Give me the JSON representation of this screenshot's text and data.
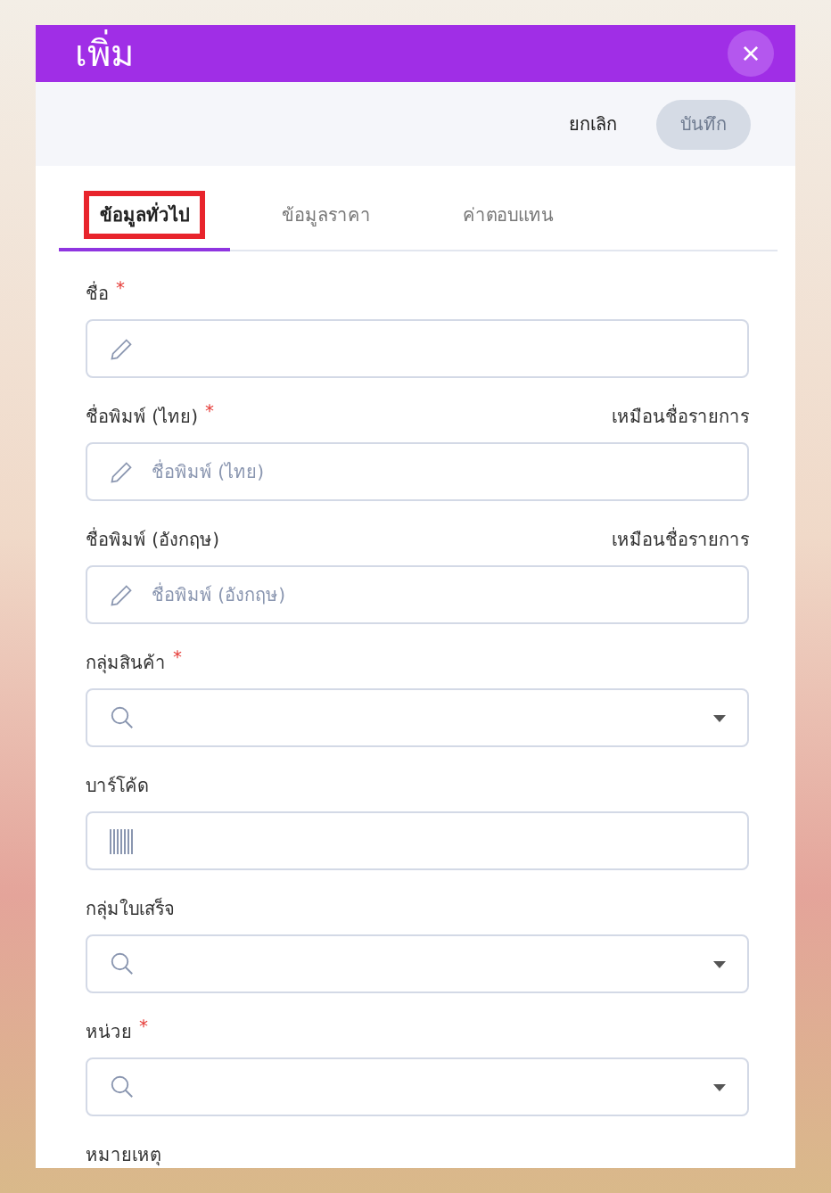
{
  "dialog": {
    "title": "เพิ่ม",
    "close": "×"
  },
  "required_mark": "*",
  "toolbar": {
    "cancel": "ยกเลิก",
    "save": {
      "label": "บันทึก",
      "disabled": true
    }
  },
  "tabs": [
    {
      "label": "ข้อมูลทั่วไป",
      "selected": true,
      "highlighted": true
    },
    {
      "label": "ข้อมูลราคา",
      "selected": false,
      "highlighted": false
    },
    {
      "label": "ค่าตอบแทน",
      "selected": false,
      "highlighted": false
    }
  ],
  "fields": [
    {
      "label": "ชื่อ",
      "required": true,
      "kind": "text"
    },
    {
      "label": "ชื่อพิมพ์ (ไทย)",
      "required": true,
      "kind": "text",
      "link": "เหมือนชื่อรายการ",
      "placeholder": "ชื่อพิมพ์ (ไทย)"
    },
    {
      "label": "ชื่อพิมพ์ (อังกฤษ)",
      "required": false,
      "kind": "text",
      "link": "เหมือนชื่อรายการ",
      "placeholder": "ชื่อพิมพ์ (อังกฤษ)"
    },
    {
      "label": "กลุ่มสินค้า",
      "required": true,
      "kind": "select"
    },
    {
      "label": "บาร์โค้ด",
      "required": false,
      "kind": "barcode"
    },
    {
      "label": "กลุ่มใบเสร็จ",
      "required": false,
      "kind": "select"
    },
    {
      "label": "หน่วย",
      "required": true,
      "kind": "select"
    },
    {
      "label": "หมายเหตุ",
      "required": false,
      "kind": "label"
    }
  ]
}
